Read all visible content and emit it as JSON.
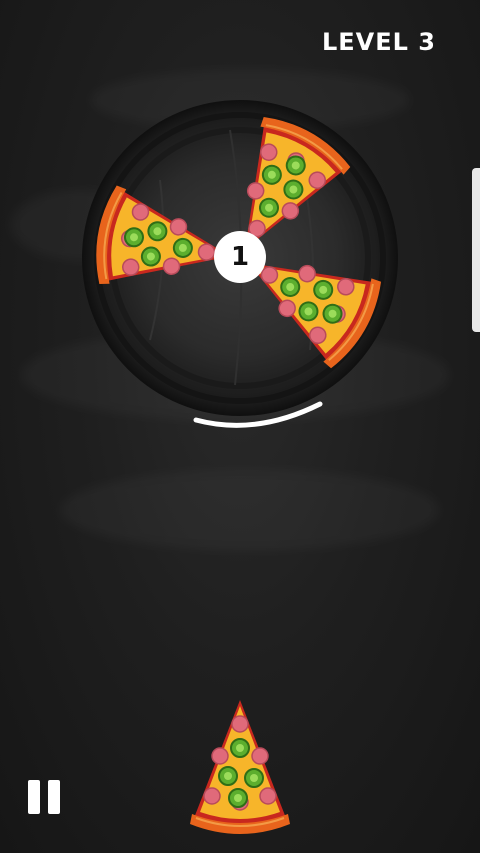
{
  "hud": {
    "level_label": "LEVEL 3"
  },
  "wheel": {
    "slices_remaining": "1",
    "placed_slices": [
      {
        "topping": "jalapeno-salami"
      },
      {
        "topping": "jalapeno-salami"
      },
      {
        "topping": "jalapeno-salami"
      }
    ]
  },
  "launcher": {
    "next_slice": {
      "topping": "jalapeno-salami"
    }
  },
  "icons": {
    "pause": "pause-icon"
  },
  "colors": {
    "background": "#1e1e1e",
    "crust": "#e8641c",
    "cheese": "#f7b52a",
    "sauce": "#c8281e",
    "jalapeno": "#5cae2e",
    "salami": "#e06a7a",
    "board": "#2b2b2b"
  }
}
